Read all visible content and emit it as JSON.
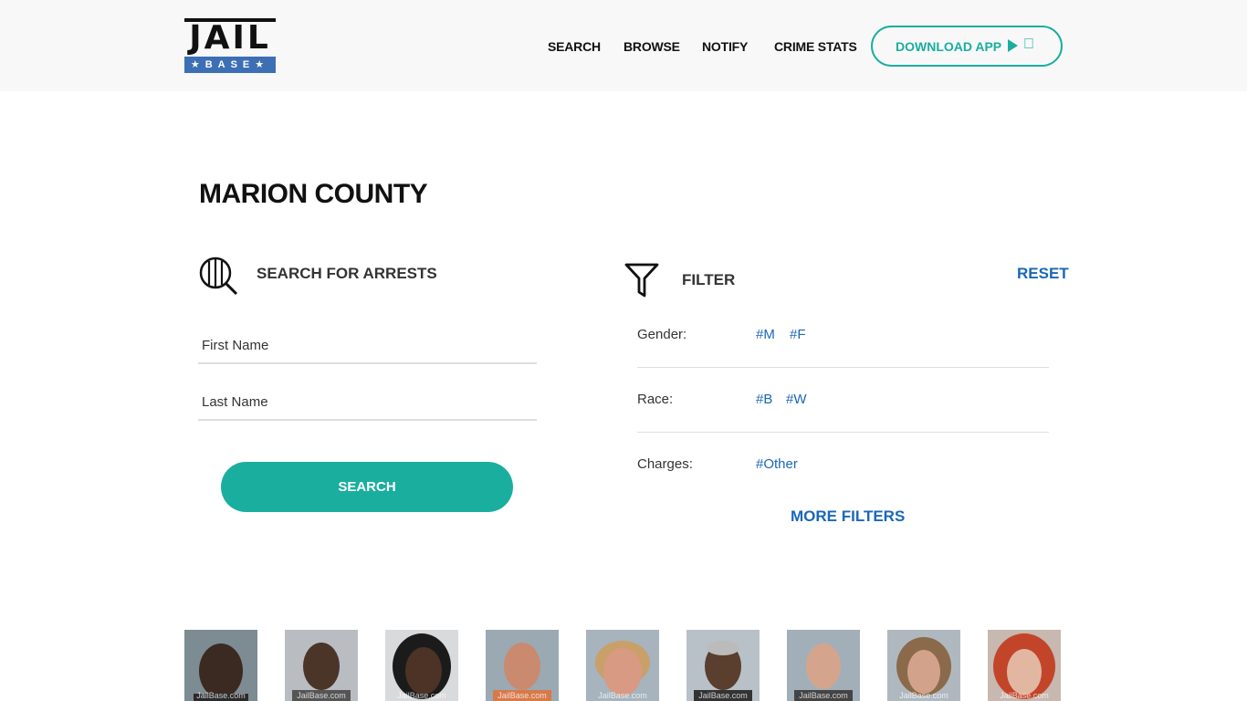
{
  "header": {
    "logo_top": "JAIL",
    "logo_bottom": "★BASE★",
    "nav": [
      {
        "label": "SEARCH"
      },
      {
        "label": "BROWSE"
      },
      {
        "label": "NOTIFY"
      },
      {
        "label": "CRIME STATS"
      }
    ],
    "download_label": "DOWNLOAD APP",
    "download_icons": [
      "play-store-icon",
      "apple-icon"
    ],
    "accent_color": "#1aae9f",
    "link_color": "#1a67b8"
  },
  "page": {
    "title": "MARION COUNTY"
  },
  "search": {
    "heading": "SEARCH FOR ARRESTS",
    "first_name_placeholder": "First Name",
    "last_name_placeholder": "Last Name",
    "button_label": "SEARCH"
  },
  "filter": {
    "heading": "FILTER",
    "reset_label": "RESET",
    "rows": [
      {
        "label": "Gender:",
        "tags": [
          "#M",
          "#F"
        ]
      },
      {
        "label": "Race:",
        "tags": [
          "#B",
          "#W"
        ]
      },
      {
        "label": "Charges:",
        "tags": [
          "#Other"
        ]
      }
    ],
    "more_label": "MORE FILTERS"
  },
  "mugshots": {
    "watermark": "JailBase.com",
    "count": 9
  }
}
